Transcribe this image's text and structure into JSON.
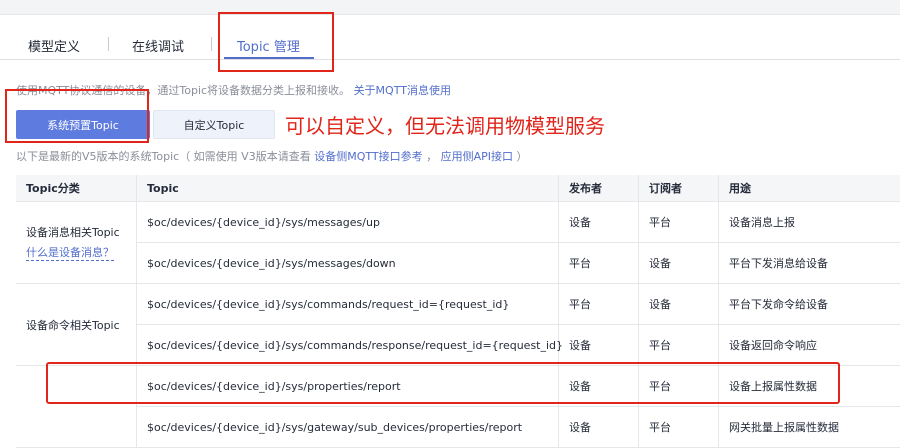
{
  "tabs": [
    {
      "label": "模型定义"
    },
    {
      "label": "在线调试"
    },
    {
      "label": "Topic 管理"
    }
  ],
  "intro": {
    "text": "使用MQTT协议通信的设备，通过Topic将设备数据分类上报和接收。",
    "link": "关于MQTT消息使用"
  },
  "buttons": {
    "preset": "系统预置Topic",
    "custom": "自定义Topic"
  },
  "annotation": "可以自定义，但无法调用物模型服务",
  "v5note": {
    "prefix": "以下是最新的V5版本的系统Topic（ 如需使用 V3版本请查看 ",
    "link1": "设备侧MQTT接口参考",
    "mid": " ， ",
    "link2": "应用侧API接口",
    "suffix": " ）"
  },
  "table": {
    "headers": [
      "Topic分类",
      "Topic",
      "发布者",
      "订阅者",
      "用途"
    ],
    "categories": [
      {
        "label": "设备消息相关Topic",
        "sublink": "什么是设备消息？"
      },
      {
        "label": "设备命令相关Topic",
        "sublink": ""
      },
      {
        "label": "",
        "sublink": ""
      }
    ],
    "rows": [
      {
        "topic": "$oc/devices/{device_id}/sys/messages/up",
        "publisher": "设备",
        "subscriber": "平台",
        "usage": "设备消息上报"
      },
      {
        "topic": "$oc/devices/{device_id}/sys/messages/down",
        "publisher": "平台",
        "subscriber": "设备",
        "usage": "平台下发消息给设备"
      },
      {
        "topic": "$oc/devices/{device_id}/sys/commands/request_id={request_id}",
        "publisher": "平台",
        "subscriber": "设备",
        "usage": "平台下发命令给设备"
      },
      {
        "topic": "$oc/devices/{device_id}/sys/commands/response/request_id={request_id}",
        "publisher": "设备",
        "subscriber": "平台",
        "usage": "设备返回命令响应"
      },
      {
        "topic": "$oc/devices/{device_id}/sys/properties/report",
        "publisher": "设备",
        "subscriber": "平台",
        "usage": "设备上报属性数据"
      },
      {
        "topic": "$oc/devices/{device_id}/sys/gateway/sub_devices/properties/report",
        "publisher": "设备",
        "subscriber": "平台",
        "usage": "网关批量上报属性数据"
      }
    ]
  }
}
